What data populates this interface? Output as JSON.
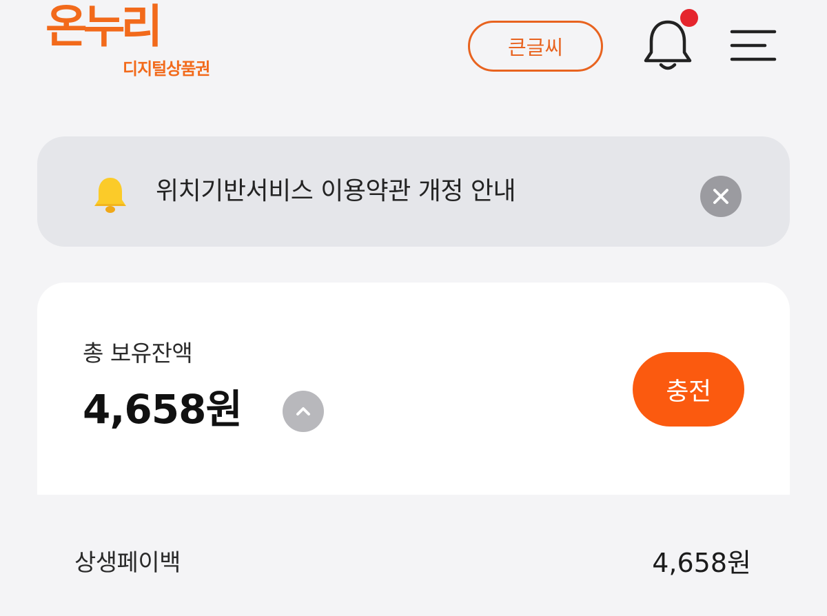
{
  "header": {
    "logo_main": "온누리",
    "logo_sub": "디지털상품권",
    "large_text_button_label": "큰글씨",
    "bell_icon": "bell-icon",
    "menu_icon": "hamburger-menu-icon",
    "notification_dot_color": "#e5252d"
  },
  "notice": {
    "icon": "bell-icon",
    "text": "위치기반서비스 이용약관 개정 안내",
    "close_icon": "close-icon"
  },
  "balance": {
    "label": "총 보유잔액",
    "amount": "4,658원",
    "toggle_icon": "chevron-up-icon",
    "charge_button_label": "충전",
    "accent_color": "#fb5a0f"
  },
  "breakdown": [
    {
      "label": "상생페이백",
      "value": "4,658원"
    }
  ]
}
